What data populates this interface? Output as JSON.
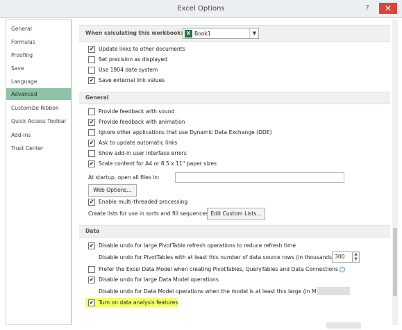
{
  "window": {
    "title": "Excel Options",
    "help_glyph": "?",
    "close_glyph": "✕"
  },
  "sidebar": {
    "items": [
      {
        "label": "General",
        "active": false
      },
      {
        "label": "Formulas",
        "active": false
      },
      {
        "label": "Proofing",
        "active": false
      },
      {
        "label": "Save",
        "active": false
      },
      {
        "label": "Language",
        "active": false
      },
      {
        "label": "Advanced",
        "active": true
      },
      {
        "label": "Customize Ribbon",
        "active": false
      },
      {
        "label": "Quick Access Toolbar",
        "active": false
      },
      {
        "label": "Add-Ins",
        "active": false
      },
      {
        "label": "Trust Center",
        "active": false
      }
    ]
  },
  "calc": {
    "label": "When calculating this workbook:",
    "workbook": "Book1",
    "excel_icon": "X",
    "checks": [
      {
        "label": "Update links to other documents",
        "checked": true
      },
      {
        "label": "Set precision as displayed",
        "checked": false
      },
      {
        "label": "Use 1904 date system",
        "checked": false
      },
      {
        "label": "Save external link values",
        "checked": true
      }
    ]
  },
  "general": {
    "header": "General",
    "checks_a": [
      {
        "label": "Provide feedback with sound",
        "checked": false
      },
      {
        "label": "Provide feedback with animation",
        "checked": true
      },
      {
        "label": "Ignore other applications that use Dynamic Data Exchange (DDE)",
        "checked": false
      },
      {
        "label": "Ask to update automatic links",
        "checked": true
      },
      {
        "label": "Show add-in user interface errors",
        "checked": false
      },
      {
        "label": "Scale content for A4 or 8.5 x 11\" paper sizes",
        "checked": true
      }
    ],
    "startup_label": "At startup, open all files in:",
    "startup_value": "",
    "web_options_button": "Web Options...",
    "multithread": {
      "label": "Enable multi-threaded processing",
      "checked": true
    },
    "custom_lists_label": "Create lists for use in sorts and fill sequences:",
    "custom_lists_button": "Edit Custom Lists..."
  },
  "data": {
    "header": "Data",
    "pivot_undo": {
      "label": "Disable undo for large PivotTable refresh operations to reduce refresh time",
      "checked": true
    },
    "pivot_rows_label": "Disable undo for PivotTables with at least this number of data source rows (in thousands):",
    "pivot_rows_value": "300",
    "prefer_model": {
      "label": "Prefer the Excel Data Model when creating PivotTables, QueryTables and Data Connections",
      "checked": false
    },
    "model_undo": {
      "label": "Disable undo for large Data Model operations",
      "checked": true
    },
    "model_size_label": "Disable undo for Data Model operations when the model is at least this large (in MB",
    "analysis": {
      "label": "Turn on data analysis features",
      "checked": true
    }
  }
}
